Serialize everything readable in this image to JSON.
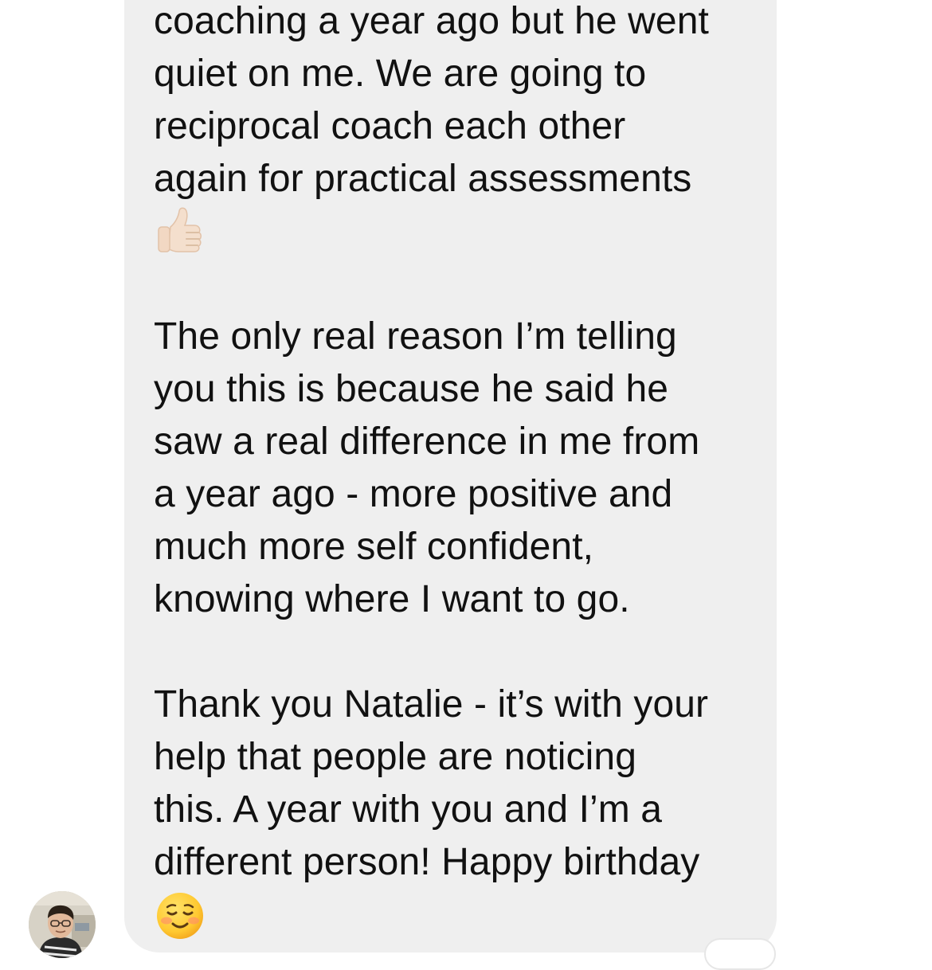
{
  "message": {
    "lines": [
      "coaching a year ago but he went",
      "quiet on me. We are going to",
      "reciprocal coach each other",
      "again for practical assessments",
      "The only real reason I’m telling",
      "you this is because he said he",
      "saw a real difference in me from",
      "a year ago - more positive and",
      "much more self confident,",
      "knowing where I want to go.",
      "Thank you Natalie - it’s with your",
      "help that people are noticing",
      "this. A year with you and I’m a",
      "different person! Happy birthday"
    ],
    "emojis": [
      "thumbs-up-light-skin-tone",
      "smiling-face"
    ]
  },
  "colors": {
    "bubble_background": "#efefef",
    "text": "#111111"
  },
  "sender": {
    "avatar_icon": "person-photo-avatar"
  }
}
